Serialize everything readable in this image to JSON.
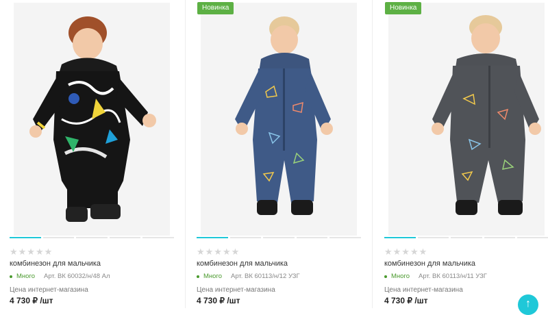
{
  "products": [
    {
      "badge": "",
      "stars": "★★★★★",
      "title": "комбинезон для мальчика",
      "stock": "Много",
      "article": "Арт. ВК 60032/н/48 Ал",
      "price_label": "Цена интернет-магазина",
      "price": "4 730 ₽ /шт"
    },
    {
      "badge": "Новинка",
      "stars": "★★★★★",
      "title": "комбинезон для мальчика",
      "stock": "Много",
      "article": "Арт. ВК 60113/н/12 УЗГ",
      "price_label": "Цена интернет-магазина",
      "price": "4 730 ₽ /шт"
    },
    {
      "badge": "Новинка",
      "stars": "★★★★★",
      "title": "комбинезон для мальчика",
      "stock": "Много",
      "article": "Арт. ВК 60113/н/11 УЗГ",
      "price_label": "Цена интернет-магазина",
      "price": "4 730 ₽ /шт"
    }
  ],
  "scroll_top_icon": "arrow-up-icon",
  "colors": {
    "accent": "#1fc8d8",
    "badge": "#5db044",
    "stock": "#4a9a2e"
  }
}
